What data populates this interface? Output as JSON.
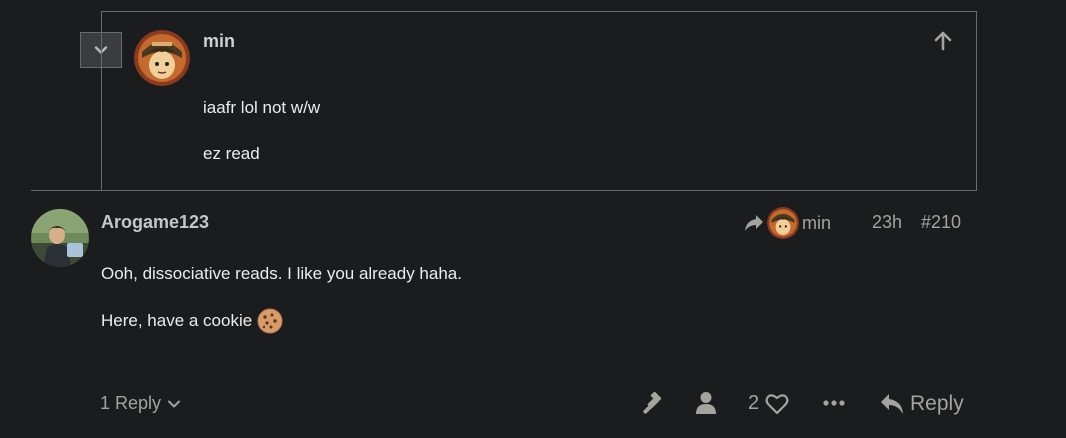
{
  "embedded_post": {
    "username": "min",
    "lines": [
      "iaafr lol not w/w",
      "ez read"
    ],
    "icons": {
      "collapse": "chevron-down-icon",
      "jump_up": "arrow-up-icon"
    }
  },
  "post": {
    "username": "Arogame123",
    "reply_to": {
      "icon": "share-arrow-icon",
      "username": "min"
    },
    "age": "23h",
    "number": "#210",
    "body": {
      "line1": "Ooh, dissociative reads. I like you already haha.",
      "line2": "Here, have a cookie"
    }
  },
  "actions": {
    "replies_label": "1 Reply",
    "like_count": "2",
    "reply_label": "Reply",
    "icons": [
      "gavel-icon",
      "user-icon",
      "heart-icon",
      "ellipsis-icon",
      "reply-arrow-icon"
    ]
  },
  "colors": {
    "background": "#1b1c1e",
    "border": "#6b6a64",
    "muted_text": "#a5a39d",
    "text": "#ececec"
  }
}
